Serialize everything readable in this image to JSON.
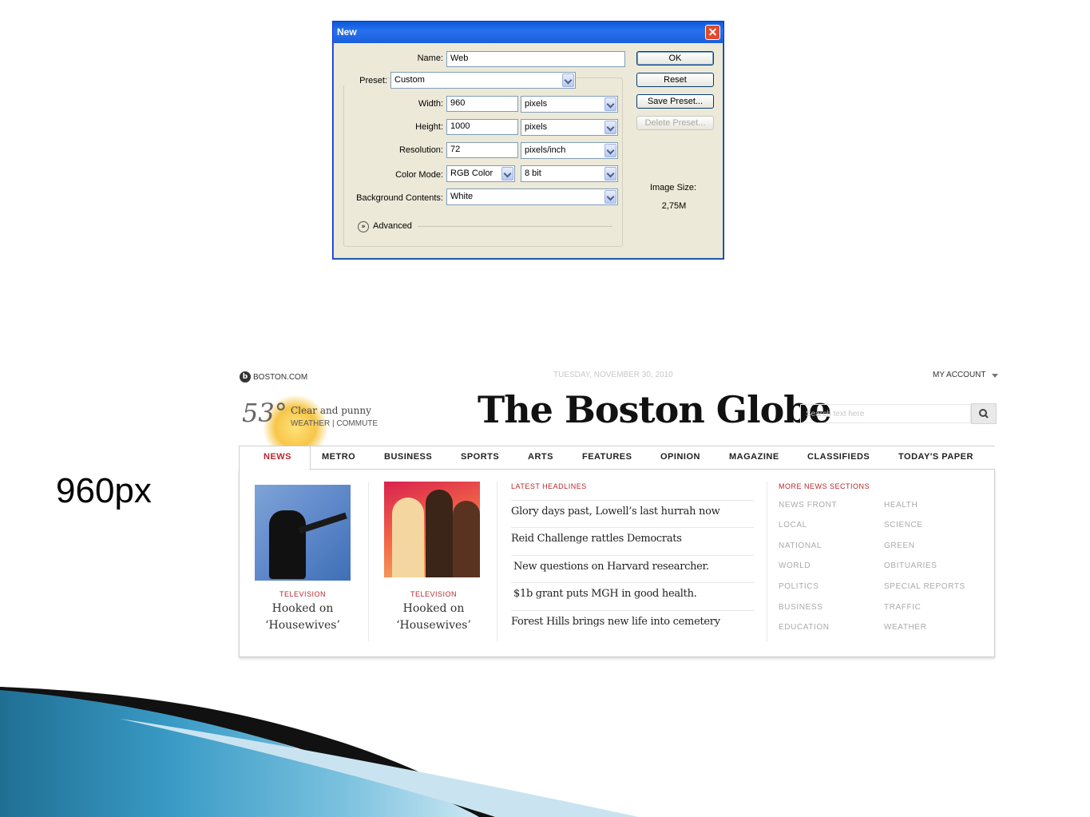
{
  "dialog": {
    "title": "New",
    "name_label": "Name:",
    "name_value": "Web",
    "preset_label": "Preset:",
    "preset_value": "Custom",
    "width_label": "Width:",
    "width_value": "960",
    "width_unit": "pixels",
    "height_label": "Height:",
    "height_value": "1000",
    "height_unit": "pixels",
    "resolution_label": "Resolution:",
    "resolution_value": "72",
    "resolution_unit": "pixels/inch",
    "color_mode_label": "Color Mode:",
    "color_mode_value": "RGB Color",
    "bit_depth_value": "8 bit",
    "background_label": "Background Contents:",
    "background_value": "White",
    "advanced_label": "Advanced",
    "ok_label": "OK",
    "reset_label": "Reset",
    "save_preset_label": "Save Preset...",
    "delete_preset_label": "Delete Preset...",
    "image_size_label": "Image Size:",
    "image_size_value": "2,75M"
  },
  "annotation": {
    "width_text": "960px"
  },
  "site": {
    "brand": "BOSTON.COM",
    "date": "TUESDAY, NOVEMBER 30, 2010",
    "account": "MY ACCOUNT",
    "masthead": "The Boston Globe",
    "weather": {
      "temp": "53°",
      "desc": "Clear and punny",
      "links": "WEATHER | COMMUTE"
    },
    "search_placeholder": "Search text here",
    "nav": [
      "NEWS",
      "METRO",
      "BUSINESS",
      "SPORTS",
      "ARTS",
      "FEATURES",
      "OPINION",
      "MAGAZINE",
      "CLASSIFIEDS",
      "TODAY'S PAPER"
    ],
    "stories": [
      {
        "kicker": "TELEVISION",
        "line1": "Hooked on",
        "line2": "‘Housewives’"
      },
      {
        "kicker": "TELEVISION",
        "line1": "Hooked on",
        "line2": "‘Housewives’"
      }
    ],
    "latest_headlines_title": "LATEST HEADLINES",
    "headlines": [
      "Glory days past, Lowell’s last hurrah now",
      "Reid Challenge rattles Democrats",
      "New questions on Harvard researcher.",
      "$1b grant puts MGH in good health.",
      "Forest Hills brings new life into cemetery"
    ],
    "more_sections_title": "MORE NEWS SECTIONS",
    "sections_left": [
      "NEWS FRONT",
      "LOCAL",
      "NATIONAL",
      "WORLD",
      "POLITICS",
      "BUSINESS",
      "EDUCATION"
    ],
    "sections_right": [
      "HEALTH",
      "SCIENCE",
      "GREEN",
      "OBITUARIES",
      "SPECIAL REPORTS",
      "TRAFFIC",
      "WEATHER"
    ]
  },
  "colors": {
    "xp_title": "#1a5fd8",
    "dialog_bg": "#ece9d8",
    "globe_red": "#b8282e",
    "swoosh_blue": "#3a9bc6"
  }
}
